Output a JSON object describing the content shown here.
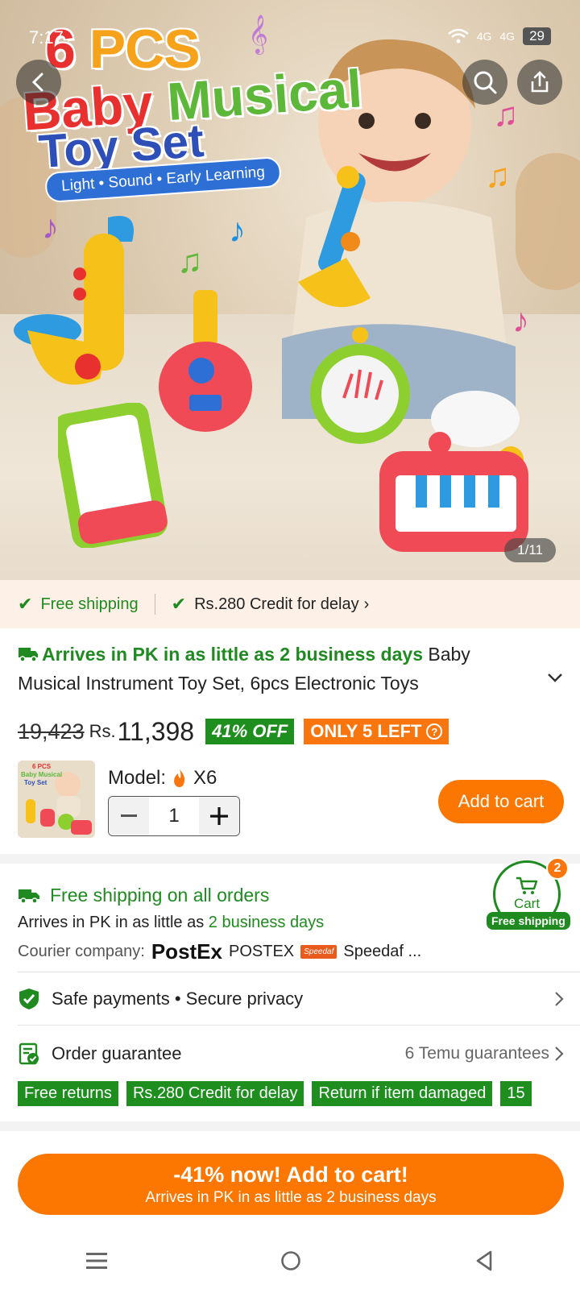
{
  "status_bar": {
    "time": "7:17",
    "network_1": "4G",
    "network_2": "4G",
    "battery": "29"
  },
  "hero": {
    "title_num": "6",
    "title_pcs": "PCS",
    "title_baby": "Baby",
    "title_musical": "Musical",
    "title_toy_set": "Toy Set",
    "banner": "Light • Sound • Early Learning",
    "pager": "1/11"
  },
  "shipping_strip": {
    "free_shipping": "Free shipping",
    "credit": "Rs.280 Credit for delay"
  },
  "product": {
    "arrives": "Arrives in PK in as little as 2 business days",
    "title": "Baby Musical Instrument Toy Set, 6pcs Electronic Toys",
    "old_price": "19,423",
    "currency": "Rs.",
    "price": "11,398",
    "discount": "41% OFF",
    "stock": "ONLY 5 LEFT",
    "model_label": "Model:",
    "model_value": "X6",
    "quantity": "1",
    "add_to_cart": "Add to cart",
    "thumb_text_1": "6 PCS",
    "thumb_text_2": "Baby Musical",
    "thumb_text_3": "Toy Set"
  },
  "shipping_info": {
    "title": "Free shipping on all orders",
    "arrive_prefix": "Arrives in PK in as little as",
    "arrive_days": "2 business days",
    "courier_label": "Courier company:",
    "courier_1_logo": "PostEx",
    "courier_1": "POSTEX",
    "courier_2_logo": "Speedaf",
    "courier_2": "Speedaf ..."
  },
  "cart_float": {
    "label": "Cart",
    "count": "2",
    "free": "Free shipping"
  },
  "safe_payments": "Safe payments • Secure privacy",
  "guarantee": {
    "label": "Order guarantee",
    "count": "6 Temu guarantees",
    "tags": [
      "Free returns",
      "Rs.280 Credit for delay",
      "Return if item damaged",
      "15"
    ]
  },
  "cta": {
    "line1": "-41% now! Add to cart!",
    "line2": "Arrives in PK in as little as 2 business days"
  },
  "colors": {
    "accent": "#fb7701",
    "green": "#1f8a1f",
    "strip_bg": "#fdf1e7"
  }
}
